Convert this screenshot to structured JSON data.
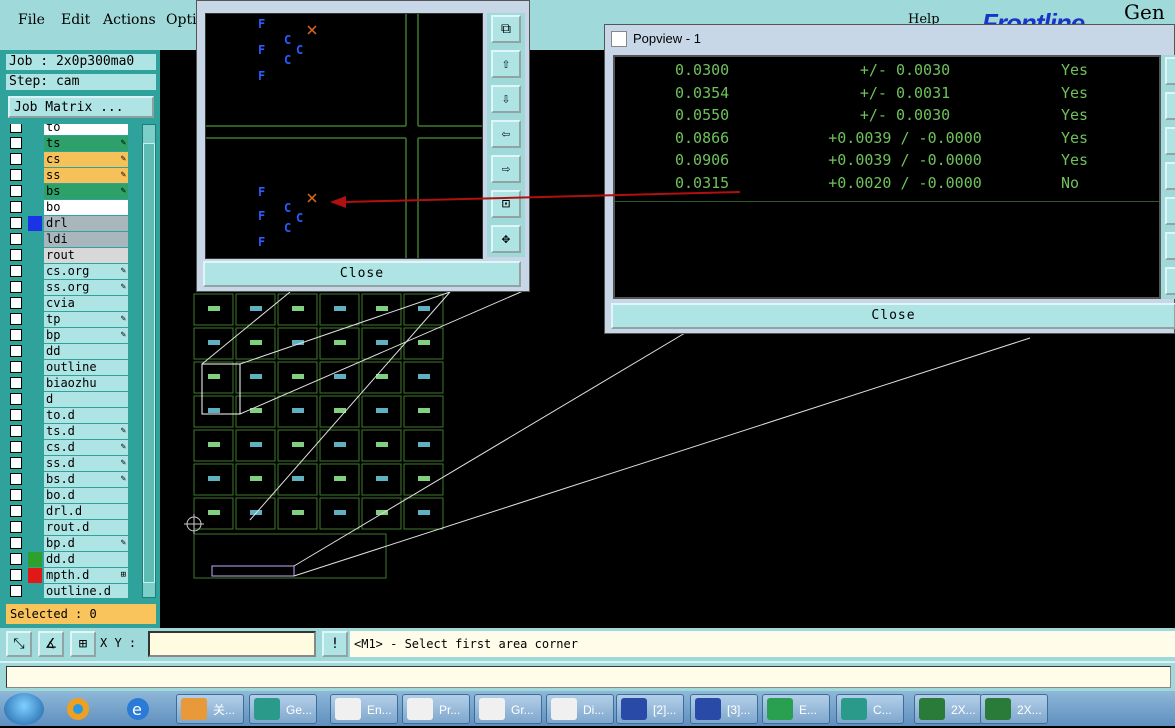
{
  "menu": {
    "items": [
      "File",
      "Edit",
      "Actions",
      "Opti"
    ],
    "help": "Help",
    "brand": "Frontline",
    "brand_tail": "Gen"
  },
  "job": {
    "job_line": "Job : 2x0p300ma0",
    "step_line": "Step: cam",
    "matrix_button": "Job Matrix ..."
  },
  "layers": [
    {
      "name": "to",
      "color": "#ffffff",
      "ctx": "",
      "mark": ""
    },
    {
      "name": "ts",
      "color": "#2ea06a",
      "ctx": "",
      "mark": "✎"
    },
    {
      "name": "cs",
      "color": "#f7c15a",
      "ctx": "",
      "mark": "✎"
    },
    {
      "name": "ss",
      "color": "#f7c15a",
      "ctx": "",
      "mark": "✎"
    },
    {
      "name": "bs",
      "color": "#2ea06a",
      "ctx": "",
      "mark": "✎"
    },
    {
      "name": "bo",
      "color": "#ffffff",
      "ctx": "",
      "mark": ""
    },
    {
      "name": "drl",
      "color": "#a9b7bd",
      "ctx": "#1a33e6",
      "mark": ""
    },
    {
      "name": "ldi",
      "color": "#a9b7bd",
      "ctx": "",
      "mark": ""
    },
    {
      "name": "rout",
      "color": "#d8d8d8",
      "ctx": "",
      "mark": ""
    },
    {
      "name": "cs.org",
      "color": "#aee4e4",
      "ctx": "",
      "mark": "✎"
    },
    {
      "name": "ss.org",
      "color": "#aee4e4",
      "ctx": "",
      "mark": "✎"
    },
    {
      "name": "cvia",
      "color": "#aee4e4",
      "ctx": "",
      "mark": ""
    },
    {
      "name": "tp",
      "color": "#aee4e4",
      "ctx": "",
      "mark": "✎"
    },
    {
      "name": "bp",
      "color": "#aee4e4",
      "ctx": "",
      "mark": "✎"
    },
    {
      "name": "dd",
      "color": "#aee4e4",
      "ctx": "",
      "mark": ""
    },
    {
      "name": "outline",
      "color": "#aee4e4",
      "ctx": "",
      "mark": ""
    },
    {
      "name": "biaozhu",
      "color": "#aee4e4",
      "ctx": "",
      "mark": ""
    },
    {
      "name": "d",
      "color": "#aee4e4",
      "ctx": "",
      "mark": ""
    },
    {
      "name": "to.d",
      "color": "#aee4e4",
      "ctx": "",
      "mark": ""
    },
    {
      "name": "ts.d",
      "color": "#aee4e4",
      "ctx": "",
      "mark": "✎"
    },
    {
      "name": "cs.d",
      "color": "#aee4e4",
      "ctx": "",
      "mark": "✎"
    },
    {
      "name": "ss.d",
      "color": "#aee4e4",
      "ctx": "",
      "mark": "✎"
    },
    {
      "name": "bs.d",
      "color": "#aee4e4",
      "ctx": "",
      "mark": "✎"
    },
    {
      "name": "bo.d",
      "color": "#aee4e4",
      "ctx": "",
      "mark": ""
    },
    {
      "name": "drl.d",
      "color": "#aee4e4",
      "ctx": "",
      "mark": ""
    },
    {
      "name": "rout.d",
      "color": "#aee4e4",
      "ctx": "",
      "mark": ""
    },
    {
      "name": "bp.d",
      "color": "#aee4e4",
      "ctx": "",
      "mark": "✎"
    },
    {
      "name": "dd.d",
      "color": "#aee4e4",
      "ctx": "#2ea02e",
      "mark": ""
    },
    {
      "name": "mpth.d",
      "color": "#aee4e4",
      "ctx": "#e01818",
      "mark": "⊞"
    },
    {
      "name": "outline.d",
      "color": "#aee4e4",
      "ctx": "",
      "mark": ""
    }
  ],
  "selected": "Selected : 0",
  "bottom": {
    "xy_label": "X Y :",
    "message": "<M1> - Select first area corner",
    "excl": "!"
  },
  "popup_small": {
    "close": "Close"
  },
  "popview": {
    "title": "Popview - 1",
    "close": "Close",
    "rows": [
      {
        "value": "0.0300",
        "tol": "+/- 0.0030",
        "ok": "Yes"
      },
      {
        "value": "0.0354",
        "tol": "+/- 0.0031",
        "ok": "Yes"
      },
      {
        "value": "0.0550",
        "tol": "+/- 0.0030",
        "ok": "Yes"
      },
      {
        "value": "0.0866",
        "tol": "+0.0039 / -0.0000",
        "ok": "Yes"
      },
      {
        "value": "0.0906",
        "tol": "+0.0039 / -0.0000",
        "ok": "Yes"
      },
      {
        "value": "0.0315",
        "tol": "+0.0020 / -0.0000",
        "ok": "No"
      }
    ]
  },
  "taskbar": {
    "items": [
      "关...",
      "Ge...",
      "En...",
      "Pr...",
      "Gr...",
      "Di...",
      "[2]...",
      "[3]...",
      "E...",
      "C...",
      "2X...",
      "2X..."
    ],
    "item_colors": [
      "#e89a3a",
      "#2a9a8a",
      "#f0f0f0",
      "#f0f0f0",
      "#f0f0f0",
      "#f0f0f0",
      "#2a4aa8",
      "#2a4aa8",
      "#28a050",
      "#2a9a8a",
      "#2a7a3a",
      "#2a7a3a"
    ]
  }
}
